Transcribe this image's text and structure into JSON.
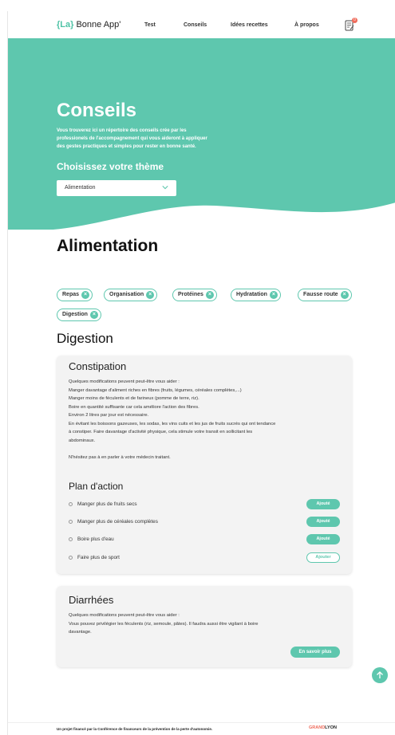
{
  "header": {
    "logo_bracket_open": "{",
    "logo_la": "La",
    "logo_bracket_close": "}",
    "logo_rest": " Bonne App'",
    "nav": [
      "Test",
      "Conseils",
      "Idées recettes",
      "À propos"
    ],
    "notification_count": "0",
    "notification_icon": "notepad-icon"
  },
  "hero": {
    "title": "Conseils",
    "description": "Vous trouverez ici un répertoire des conseils crée par les professionels de l'accompagnement qui vous aideront à appliquer des gestes practiques et simples pour rester en bonne santé.",
    "theme_label": "Choisissez votre thème",
    "select_value": "Alimentation"
  },
  "main": {
    "section_title": "Alimentation",
    "chips": [
      "Repas",
      "Organisation",
      "Protéines",
      "Hydratation",
      "Fausse route",
      "Digestion"
    ],
    "subsection_title": "Digestion",
    "cards": [
      {
        "title": "Constipation",
        "lines": [
          "Quelques modifications peuvent peut-être vous aider :",
          "Manger davantage d'aliment riches en fibres (fruits, légumes, céréales complètes,...)",
          "Manger moins de féculents et de farineux (pomme de terre, riz).",
          "Boire en quantité suffisante car cela améliore l'action des fibres.",
          "Environ 2 litres par jour est nécessaire.",
          "En évitant les boissons gazeuses, les sodas, les vins cuits et les jus de fruits sucrés qui ont tendance",
          "à constiper. Faire davantage d'activité physique, cela stimule votre transit en sollicitant les",
          "abdominaux.",
          "",
          "N'hésitez pas à en parler à votre médecin traitant."
        ],
        "plan_title": "Plan d'action",
        "plan": [
          {
            "label": "Manger plus de fruits secs",
            "button": "Ajouté",
            "active": true
          },
          {
            "label": "Manger plus de céréales complètes",
            "button": "Ajouté",
            "active": true
          },
          {
            "label": "Boire plus d'eau",
            "button": "Ajouté",
            "active": true
          },
          {
            "label": "Faire plus de sport",
            "button": "Ajouter",
            "active": false
          }
        ]
      },
      {
        "title": "Diarrhées",
        "lines": [
          "Quelques modifications peuvent peut-être vous aider :",
          "Vous pouvez privilégier les féculents (riz, semoule, pâtes). Il faudra aussi être vigilant à boire",
          "davantage."
        ],
        "button": "En savoir plus"
      }
    ]
  },
  "footer": {
    "text": "Un projet financé par la Conférence de financeurs de la prévention de la perte d'autonomie.",
    "logo_a": "GRAND",
    "logo_b": "LYON"
  },
  "colors": {
    "accent": "#5ec7ae",
    "badge": "#ef6b5b"
  }
}
